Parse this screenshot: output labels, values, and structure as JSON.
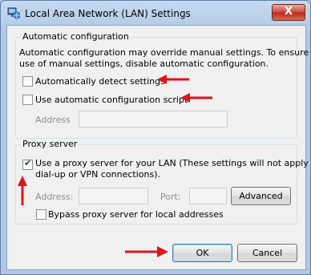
{
  "window": {
    "title": "Local Area Network (LAN) Settings",
    "close_glyph": "X"
  },
  "auto_config": {
    "legend": "Automatic configuration",
    "description_line1": "Automatic configuration may override manual settings.  To ensure the",
    "description_line2": "use of manual settings, disable automatic configuration.",
    "detect_label": "Automatically detect settings",
    "detect_checked": false,
    "script_label": "Use automatic configuration script",
    "script_checked": false,
    "address_label": "Address",
    "address_value": ""
  },
  "proxy": {
    "legend": "Proxy server",
    "use_proxy_line1": "Use a proxy server for your LAN (These settings will not apply to",
    "use_proxy_line2": "dial-up or VPN connections).",
    "use_proxy_checked": true,
    "address_label": "Address:",
    "address_value": "",
    "port_label": "Port:",
    "port_value": "",
    "advanced_label": "Advanced",
    "bypass_label": "Bypass proxy server for local addresses",
    "bypass_checked": false
  },
  "buttons": {
    "ok_label": "OK",
    "cancel_label": "Cancel"
  },
  "colors": {
    "annotation_arrow": "#e0141b"
  }
}
